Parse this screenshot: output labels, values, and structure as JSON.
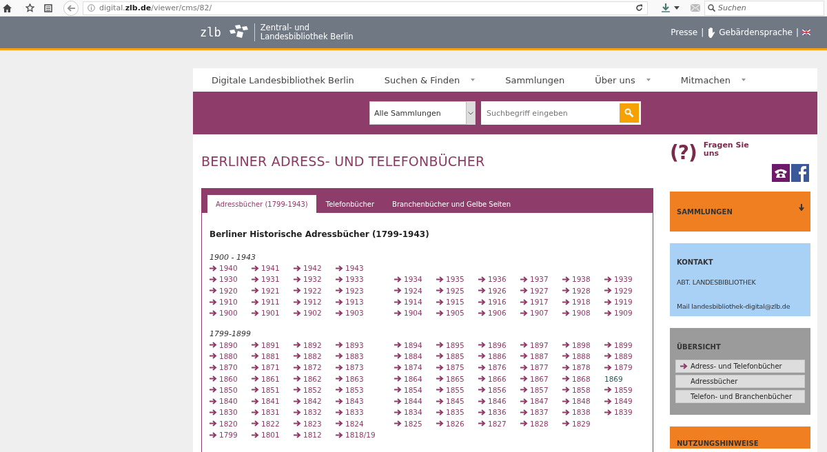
{
  "browser": {
    "url": "digital.**zlb.de**/viewer/cms/82/",
    "search_placeholder": "Suchen"
  },
  "header": {
    "logo_text": "zlb",
    "org_line_1": "Zentral- und",
    "org_line_2": "Landesbibliothek Berlin",
    "links": [
      "Presse",
      "Gebärdensprache"
    ],
    "separator": "|"
  },
  "nav": {
    "items": [
      {
        "label": "Digitale Landesbibliothek Berlin",
        "dropdown": false
      },
      {
        "label": "Suchen & Finden",
        "dropdown": true
      },
      {
        "label": "Sammlungen",
        "dropdown": false
      },
      {
        "label": "Über uns",
        "dropdown": true
      },
      {
        "label": "Mitmachen",
        "dropdown": true
      }
    ]
  },
  "search": {
    "select_value": "Alle Sammlungen",
    "placeholder": "Suchbegriff eingeben"
  },
  "page_title": "BERLINER ADRESS- UND TELEFONBÜCHER",
  "tabs": [
    {
      "label": "Adressbücher (1799-1943)",
      "selected": true
    },
    {
      "label": "Telefonbücher",
      "selected": false
    },
    {
      "label": "Branchenbücher und Gelbe Seiten",
      "selected": false
    }
  ],
  "section_title": "Berliner Historische Adressbücher (1799-1943)",
  "groups": [
    {
      "label": "1900 - 1943",
      "rows": [
        [
          {
            "year": "1940",
            "linked": true
          },
          {
            "year": "1941",
            "linked": true
          },
          {
            "year": "1942",
            "linked": true
          },
          {
            "year": "1943",
            "linked": true
          }
        ],
        [
          {
            "year": "1930",
            "linked": true
          },
          {
            "year": "1931",
            "linked": true
          },
          {
            "year": "1932",
            "linked": true
          },
          {
            "year": "1933",
            "linked": true
          },
          {
            "year": "1934",
            "linked": true
          },
          {
            "year": "1935",
            "linked": true
          },
          {
            "year": "1936",
            "linked": true
          },
          {
            "year": "1937",
            "linked": true
          },
          {
            "year": "1938",
            "linked": true
          },
          {
            "year": "1939",
            "linked": true
          }
        ],
        [
          {
            "year": "1920",
            "linked": true
          },
          {
            "year": "1921",
            "linked": true
          },
          {
            "year": "1922",
            "linked": true
          },
          {
            "year": "1923",
            "linked": true
          },
          {
            "year": "1924",
            "linked": true
          },
          {
            "year": "1925",
            "linked": true
          },
          {
            "year": "1926",
            "linked": true
          },
          {
            "year": "1927",
            "linked": true
          },
          {
            "year": "1928",
            "linked": true
          },
          {
            "year": "1929",
            "linked": true
          }
        ],
        [
          {
            "year": "1910",
            "linked": true
          },
          {
            "year": "1911",
            "linked": true
          },
          {
            "year": "1912",
            "linked": true
          },
          {
            "year": "1913",
            "linked": true
          },
          {
            "year": "1914",
            "linked": true
          },
          {
            "year": "1915",
            "linked": true
          },
          {
            "year": "1916",
            "linked": true
          },
          {
            "year": "1917",
            "linked": true
          },
          {
            "year": "1918",
            "linked": true
          },
          {
            "year": "1919",
            "linked": true
          }
        ],
        [
          {
            "year": "1900",
            "linked": true
          },
          {
            "year": "1901",
            "linked": true
          },
          {
            "year": "1902",
            "linked": true
          },
          {
            "year": "1903",
            "linked": true
          },
          {
            "year": "1904",
            "linked": true
          },
          {
            "year": "1905",
            "linked": true
          },
          {
            "year": "1906",
            "linked": true
          },
          {
            "year": "1907",
            "linked": true
          },
          {
            "year": "1908",
            "linked": true
          },
          {
            "year": "1909",
            "linked": true
          }
        ]
      ]
    },
    {
      "label": "1799-1899",
      "rows": [
        [
          {
            "year": "1890",
            "linked": true
          },
          {
            "year": "1891",
            "linked": true
          },
          {
            "year": "1892",
            "linked": true
          },
          {
            "year": "1893",
            "linked": true
          },
          {
            "year": "1894",
            "linked": true
          },
          {
            "year": "1895",
            "linked": true
          },
          {
            "year": "1896",
            "linked": true
          },
          {
            "year": "1897",
            "linked": true
          },
          {
            "year": "1898",
            "linked": true
          },
          {
            "year": "1899",
            "linked": true
          }
        ],
        [
          {
            "year": "1880",
            "linked": true
          },
          {
            "year": "1881",
            "linked": true
          },
          {
            "year": "1882",
            "linked": true
          },
          {
            "year": "1883",
            "linked": true
          },
          {
            "year": "1884",
            "linked": true
          },
          {
            "year": "1885",
            "linked": true
          },
          {
            "year": "1886",
            "linked": true
          },
          {
            "year": "1887",
            "linked": true
          },
          {
            "year": "1888",
            "linked": true
          },
          {
            "year": "1889",
            "linked": true
          }
        ],
        [
          {
            "year": "1870",
            "linked": true
          },
          {
            "year": "1871",
            "linked": true
          },
          {
            "year": "1872",
            "linked": true
          },
          {
            "year": "1873",
            "linked": true
          },
          {
            "year": "1874",
            "linked": true
          },
          {
            "year": "1875",
            "linked": true
          },
          {
            "year": "1876",
            "linked": true
          },
          {
            "year": "1877",
            "linked": true
          },
          {
            "year": "1878",
            "linked": true
          },
          {
            "year": "1879",
            "linked": true
          }
        ],
        [
          {
            "year": "1860",
            "linked": true
          },
          {
            "year": "1861",
            "linked": true
          },
          {
            "year": "1862",
            "linked": true
          },
          {
            "year": "1863",
            "linked": true
          },
          {
            "year": "1864",
            "linked": true
          },
          {
            "year": "1865",
            "linked": true
          },
          {
            "year": "1866",
            "linked": true
          },
          {
            "year": "1867",
            "linked": true
          },
          {
            "year": "1868",
            "linked": true
          },
          {
            "year": "1869",
            "linked": false
          }
        ],
        [
          {
            "year": "1850",
            "linked": true
          },
          {
            "year": "1851",
            "linked": true
          },
          {
            "year": "1852",
            "linked": true
          },
          {
            "year": "1853",
            "linked": true
          },
          {
            "year": "1854",
            "linked": true
          },
          {
            "year": "1855",
            "linked": true
          },
          {
            "year": "1856",
            "linked": true
          },
          {
            "year": "1857",
            "linked": true
          },
          {
            "year": "1858",
            "linked": true
          },
          {
            "year": "1859",
            "linked": true
          }
        ],
        [
          {
            "year": "1840",
            "linked": true
          },
          {
            "year": "1841",
            "linked": true
          },
          {
            "year": "1842",
            "linked": true
          },
          {
            "year": "1843",
            "linked": true
          },
          {
            "year": "1844",
            "linked": true
          },
          {
            "year": "1845",
            "linked": true
          },
          {
            "year": "1846",
            "linked": true
          },
          {
            "year": "1847",
            "linked": true
          },
          {
            "year": "1848",
            "linked": true
          },
          {
            "year": "1849",
            "linked": true
          }
        ],
        [
          {
            "year": "1830",
            "linked": true
          },
          {
            "year": "1831",
            "linked": true
          },
          {
            "year": "1832",
            "linked": true
          },
          {
            "year": "1833",
            "linked": true
          },
          {
            "year": "1834",
            "linked": true
          },
          {
            "year": "1835",
            "linked": true
          },
          {
            "year": "1836",
            "linked": true
          },
          {
            "year": "1837",
            "linked": true
          },
          {
            "year": "1838",
            "linked": true
          },
          {
            "year": "1839",
            "linked": true
          }
        ],
        [
          {
            "year": "1820",
            "linked": true
          },
          {
            "year": "1822",
            "linked": true
          },
          {
            "year": "1823",
            "linked": true
          },
          {
            "year": "1824",
            "linked": true
          },
          {
            "year": "1825",
            "linked": true
          },
          {
            "year": "1826",
            "linked": true
          },
          {
            "year": "1827",
            "linked": true
          },
          {
            "year": "1828",
            "linked": true
          },
          {
            "year": "1829",
            "linked": true
          }
        ],
        [
          {
            "year": "1799",
            "linked": true
          },
          {
            "year": "1801",
            "linked": true
          },
          {
            "year": "1812",
            "linked": true
          },
          {
            "year": "1818/19",
            "linked": true
          }
        ]
      ]
    }
  ],
  "sidebar": {
    "ask": {
      "icon": "(?)",
      "line_1": "Fragen Sie",
      "line_2": "uns"
    },
    "boxes": [
      {
        "kind": "toggle",
        "title": "SAMMLUNGEN"
      },
      {
        "kind": "contact",
        "title": "KONTAKT",
        "lines": [
          "ABT. LANDESBIBLIOTHEK",
          "Mail landesbibliothek-digital@zlb.de"
        ]
      },
      {
        "kind": "menu",
        "title": "ÜBERSICHT",
        "items": [
          {
            "label": "Adress- und Telefonbücher",
            "selected": true
          },
          {
            "label": "Adressbücher",
            "selected": false
          },
          {
            "label": "Telefon- und Branchenbücher",
            "selected": false
          }
        ]
      },
      {
        "kind": "toggle_cut",
        "title": "NUTZUNGSHINWEISE"
      }
    ]
  }
}
